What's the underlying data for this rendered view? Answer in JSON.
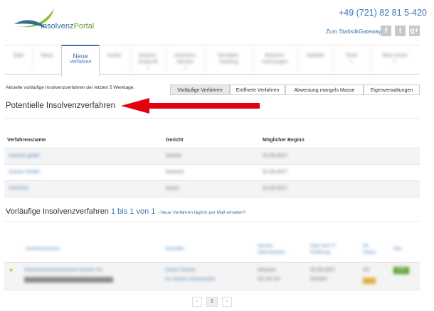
{
  "header": {
    "logo": {
      "part1": "Insolvenz",
      "part2": "Portal"
    },
    "phone": "+49 (721) 82 81 5-420",
    "gateway_link": "Zum StatistikGateway",
    "social": [
      {
        "name": "facebook-icon",
        "glyph": "f"
      },
      {
        "name": "twitter-icon",
        "glyph": "t"
      },
      {
        "name": "google-plus-icon",
        "glyph": "g+"
      }
    ]
  },
  "nav": {
    "items": [
      {
        "l1": "Start",
        "l2": ""
      },
      {
        "l1": "News",
        "l2": ""
      },
      {
        "l1": "Neue",
        "l2": "Verfahren",
        "active": true
      },
      {
        "l1": "Suche",
        "l2": ""
      },
      {
        "l1": "Inkasso-",
        "l2": "Auskunft"
      },
      {
        "l1": "Insolvenz-",
        "l2": "Monitor"
      },
      {
        "l1": "Verwalter-",
        "l2": "Ranking"
      },
      {
        "l1": "Bekannt-",
        "l2": "machungen"
      },
      {
        "l1": "Statistik",
        "l2": ""
      },
      {
        "l1": "Tools",
        "l2": ""
      },
      {
        "l1": "Mein Konto",
        "l2": ""
      }
    ]
  },
  "subnav": {
    "description": "Aktuelle vorläufige Insolvenzverfahren der letzten 5 Werktage.",
    "tabs": [
      "Vorläufige Verfahren",
      "Eröffnete Verfahren",
      "Abweisung mangels Masse",
      "Eigenverwaltungen"
    ]
  },
  "potential": {
    "title": "Potentielle Insolvenzverfahren",
    "columns": [
      "Verfahrensname",
      "Gericht",
      "Möglicher Beginn"
    ],
    "rows": [
      {
        "name": "xxxxxxx gmbh",
        "court": "Xxxxxx",
        "date": "31.03.2017"
      },
      {
        "name": "Xxxxxx GmbH",
        "court": "Xxxxxxx",
        "date": "31.03.2017"
      },
      {
        "name": "XXXXXX",
        "court": "Xxxxx",
        "date": "31.03.2017"
      }
    ]
  },
  "provisional": {
    "title": "Vorläufige Insolvenzverfahren",
    "count": "1 bis 1 von 1",
    "mail_link": "- Neue Verfahren täglich per Mail erhalten?",
    "columns": [
      "Verfahrensname",
      "Verwalter",
      "Gericht Aktenzeichen",
      "Start Verf.?? Eröffnung",
      "Alt Status",
      "Neu"
    ],
    "row": {
      "name": "Xxxxxxxxxxxxxxxxxxxxx Xxxxxx XX",
      "name2": "Xxxxxxxxxx Xxxxxxx",
      "admin1": "Xxxxx Xxxxxx",
      "admin2": "Xx Xxxxxx Xxxxxxxxxx",
      "court1": "Xxxxxxx",
      "court2": "XX XX XX",
      "date1": "31.03.2017",
      "date2": "XXXXX",
      "status": "XX",
      "badge": "XXX"
    }
  },
  "pager": {
    "prev": "‹",
    "current": "1",
    "next": "›"
  },
  "colors": {
    "accent": "#3b76b0",
    "arrow": "#e4000f",
    "badge_new": "#5aa02c",
    "badge_status": "#e0b040"
  }
}
